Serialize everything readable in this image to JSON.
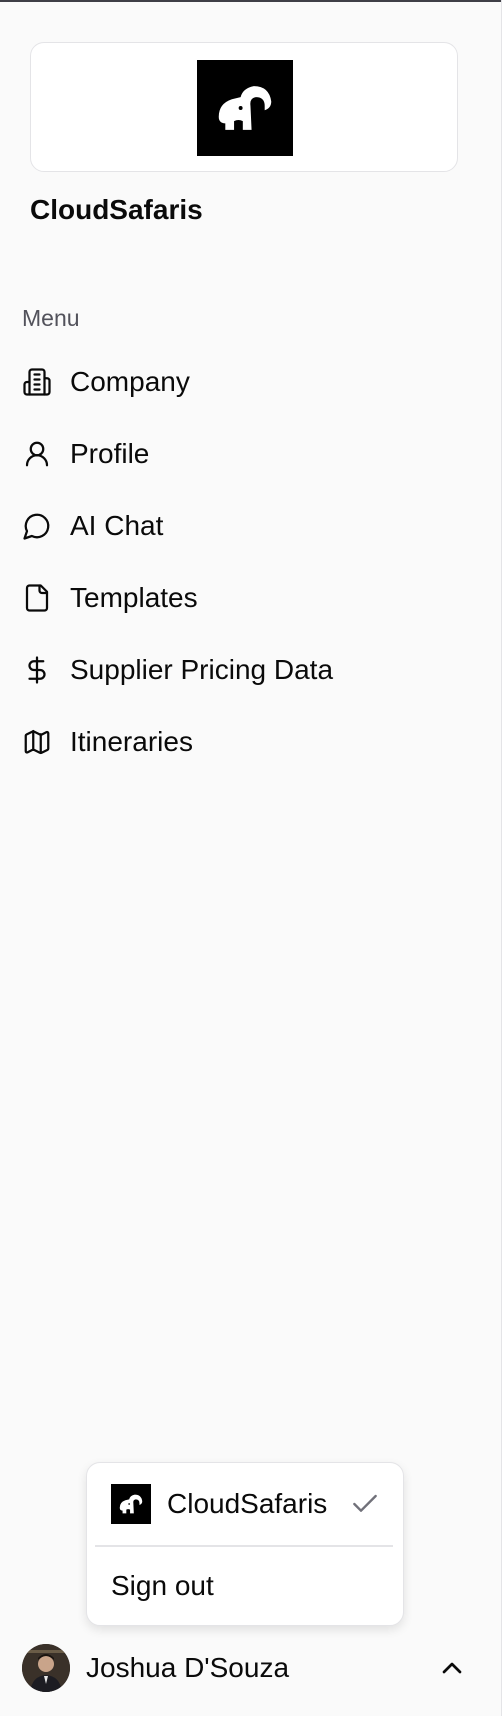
{
  "brand": {
    "name": "CloudSafaris",
    "logo_icon": "elephant-logo"
  },
  "sidebar": {
    "menu_label": "Menu",
    "items": [
      {
        "label": "Company",
        "icon": "building-icon"
      },
      {
        "label": "Profile",
        "icon": "user-icon"
      },
      {
        "label": "AI Chat",
        "icon": "chat-bubble-icon"
      },
      {
        "label": "Templates",
        "icon": "file-icon"
      },
      {
        "label": "Supplier Pricing Data",
        "icon": "dollar-icon"
      },
      {
        "label": "Itineraries",
        "icon": "map-icon"
      }
    ]
  },
  "org_menu": {
    "org_name": "CloudSafaris",
    "selected": true,
    "sign_out_label": "Sign out"
  },
  "user": {
    "name": "Joshua D'Souza"
  },
  "colors": {
    "background": "#fafafa",
    "text": "#0a0a0a",
    "muted": "#52525b",
    "border": "#e4e4e7",
    "logo_bg": "#000000"
  }
}
